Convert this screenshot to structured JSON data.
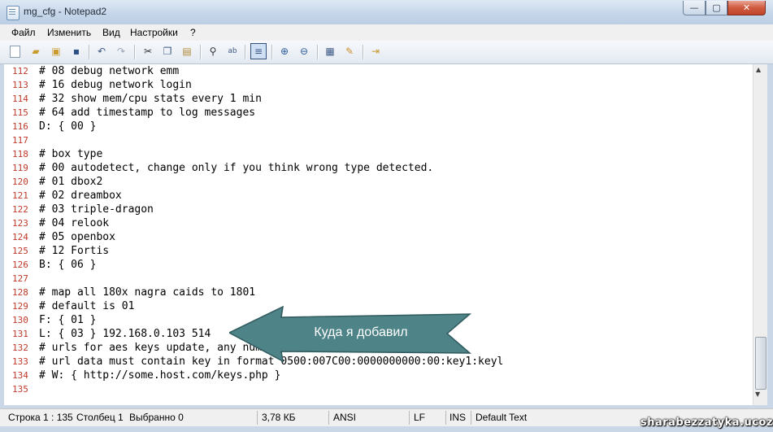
{
  "window": {
    "title": "mg_cfg - Notepad2",
    "minimize_glyph": "—",
    "maximize_glyph": "▢",
    "close_glyph": "✕"
  },
  "menu": [
    "Файл",
    "Изменить",
    "Вид",
    "Настройки",
    "?"
  ],
  "toolbar": {
    "icons": [
      "new-icon",
      "open-icon",
      "browse-icon",
      "save-icon",
      "undo-icon",
      "redo-icon",
      "cut-icon",
      "copy-icon",
      "paste-icon",
      "find-icon",
      "replace-icon",
      "word-wrap-icon",
      "zoom-in-icon",
      "zoom-out-icon",
      "scheme-icon",
      "customize-icon",
      "exit-icon"
    ],
    "active": "word-wrap-icon"
  },
  "editor": {
    "lines": [
      {
        "num": "112",
        "text": "# 08 debug network emm"
      },
      {
        "num": "113",
        "text": "# 16 debug network login"
      },
      {
        "num": "114",
        "text": "# 32 show mem/cpu stats every 1 min"
      },
      {
        "num": "115",
        "text": "# 64 add timestamp to log messages"
      },
      {
        "num": "116",
        "text": "D: { 00 }"
      },
      {
        "num": "117",
        "text": ""
      },
      {
        "num": "118",
        "text": "# box type"
      },
      {
        "num": "119",
        "text": "# 00 autodetect, change only if you think wrong type detected."
      },
      {
        "num": "120",
        "text": "# 01 dbox2"
      },
      {
        "num": "121",
        "text": "# 02 dreambox"
      },
      {
        "num": "122",
        "text": "# 03 triple-dragon"
      },
      {
        "num": "123",
        "text": "# 04 relook"
      },
      {
        "num": "124",
        "text": "# 05 openbox"
      },
      {
        "num": "125",
        "text": "# 12 Fortis"
      },
      {
        "num": "126",
        "text": "B: { 06 }"
      },
      {
        "num": "127",
        "text": ""
      },
      {
        "num": "128",
        "text": "# map all 180x nagra caids to 1801"
      },
      {
        "num": "129",
        "text": "# default is 01"
      },
      {
        "num": "130",
        "text": "F: { 01 }"
      },
      {
        "num": "131",
        "text": "L: { 03 } 192.168.0.103 514"
      },
      {
        "num": "132",
        "text": "# urls for aes keys update, any number of urls allowed,"
      },
      {
        "num": "133",
        "text": "# url data must contain key in format 0500:007C00:0000000000:00:key1:keyl"
      },
      {
        "num": "134",
        "text": "# W: { http://some.host.com/keys.php }"
      },
      {
        "num": "135",
        "text": ""
      }
    ]
  },
  "status": {
    "position": "Строка 1 : 135",
    "column": "Столбец 1",
    "selection": "Выбранно 0",
    "size": "3,78 КБ",
    "encoding": "ANSI",
    "line_ending": "LF",
    "insert_mode": "INS",
    "scheme": "Default Text"
  },
  "annotation": {
    "label": "Куда я добавил",
    "color": "#4e8388"
  },
  "watermark": "sharabezzatyka.ucoz.ru"
}
